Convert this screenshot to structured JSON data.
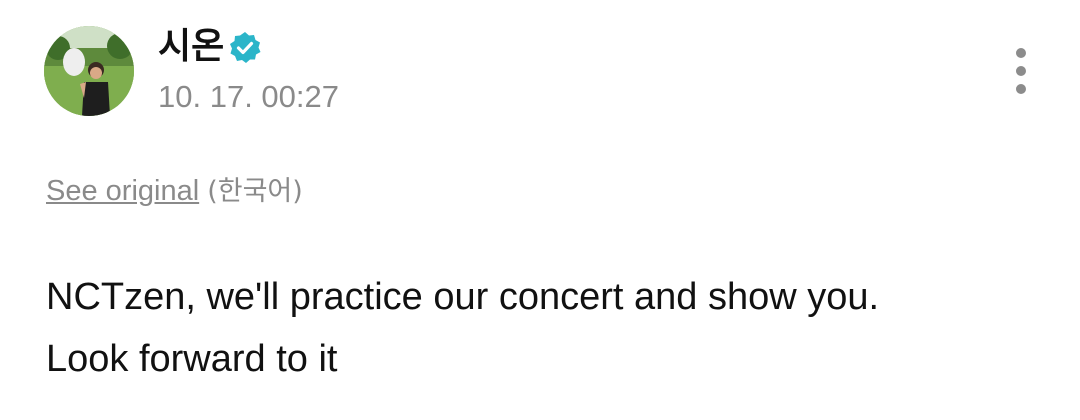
{
  "post": {
    "author": {
      "name": "시온",
      "verified_icon": "verified-badge-icon",
      "avatar_icon": "profile-photo"
    },
    "timestamp": "10. 17. 00:27",
    "more_icon": "vertical-ellipsis-icon",
    "translation": {
      "see_original_label": "See original",
      "language_note": "(한국어)"
    },
    "body_lines": [
      "NCTzen, we'll practice our concert and show you.",
      "Look forward to it"
    ]
  },
  "colors": {
    "verified": "#2bb5c9",
    "secondary_text": "#8a8a8a",
    "primary_text": "#111111"
  }
}
